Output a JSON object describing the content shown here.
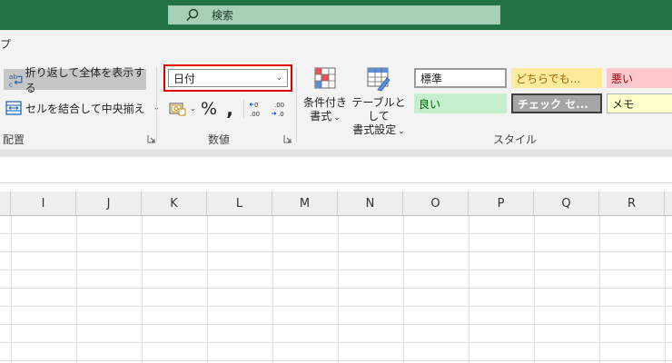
{
  "search": {
    "label": "検索",
    "icon": "search-icon"
  },
  "ribbon": {
    "tab_partial": "プ",
    "alignment": {
      "wrap_text": "折り返して全体を表示する",
      "merge_center": "セルを結合して中央揃え",
      "group_label": "配置"
    },
    "number": {
      "format_value": "日付",
      "group_label": "数値"
    },
    "styles": {
      "conditional_formatting": [
        "条件付き",
        "書式"
      ],
      "format_as_table": [
        "テーブルとして",
        "書式設定"
      ],
      "cells": [
        {
          "label": "標準"
        },
        {
          "label": "どちらでも..."
        },
        {
          "label": "悪い"
        },
        {
          "label": "良い"
        },
        {
          "label": "チェック セ..."
        },
        {
          "label": "メモ"
        }
      ],
      "group_label": "スタイル"
    }
  },
  "columns": [
    "I",
    "J",
    "K",
    "L",
    "M",
    "N",
    "O",
    "P",
    "Q",
    "R"
  ],
  "colors": {
    "titlebar": "#217346",
    "highlight": "#e00000"
  }
}
